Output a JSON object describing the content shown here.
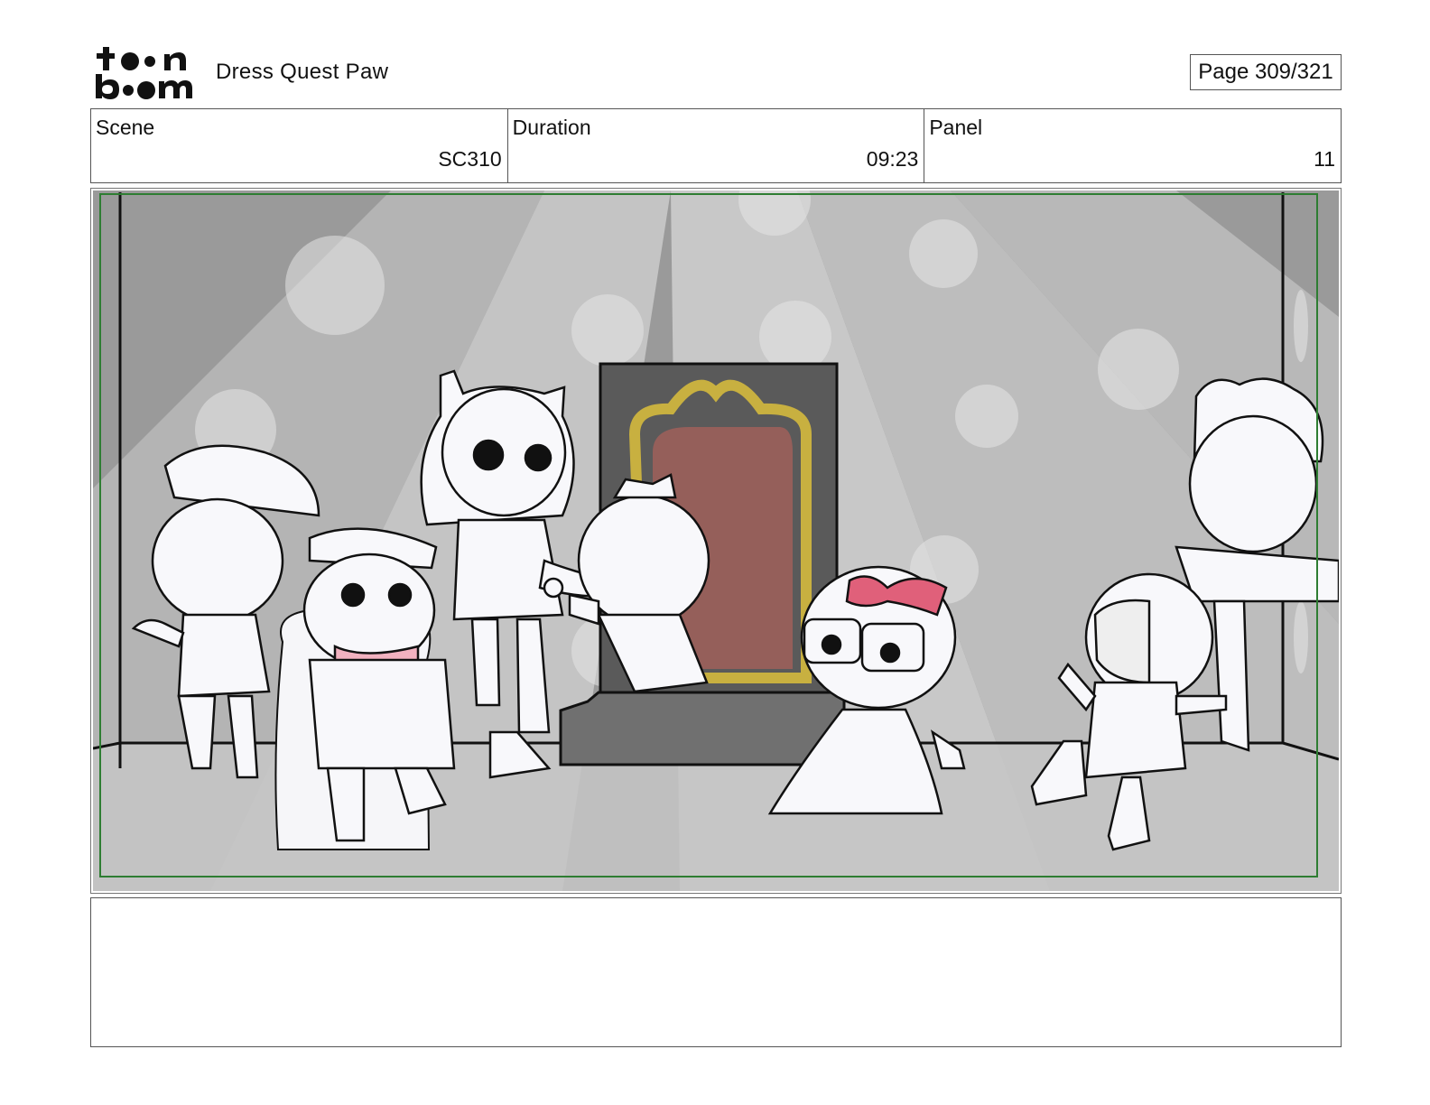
{
  "header": {
    "logo_text": "toon boom",
    "project_title": "Dress Quest Paw",
    "page_counter": "Page 309/321"
  },
  "info": {
    "scene": {
      "label": "Scene",
      "value": "SC310"
    },
    "duration": {
      "label": "Duration",
      "value": "09:23"
    },
    "panel": {
      "label": "Panel",
      "value": "11"
    }
  },
  "panel_image": {
    "icon": "storyboard-sketch",
    "safe_frame_color": "#2e7d32",
    "mirror_glass_color": "#a0605a",
    "mirror_frame_color": "#c8b040",
    "bow_color": "#e0607a"
  },
  "notes": {
    "text": ""
  }
}
